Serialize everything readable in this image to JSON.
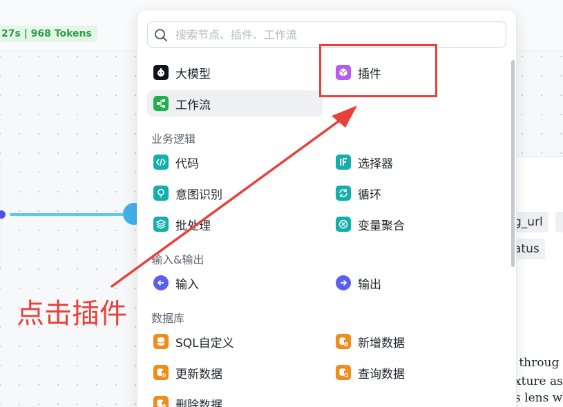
{
  "canvas": {
    "run_stats": "27s | 968 Tokens",
    "right_node": {
      "tags": [
        "g_url",
        "atus"
      ],
      "description_lines": [
        "n throug",
        "exture as",
        "es lens w"
      ]
    }
  },
  "node_picker": {
    "search": {
      "placeholder": "搜索节点、插件、工作流",
      "value": ""
    },
    "top_items": [
      {
        "label": "大模型",
        "icon": "llm-robot-icon",
        "color": "#111318"
      },
      {
        "label": "插件",
        "icon": "plugin-cube-icon",
        "color": "#b65ce8"
      },
      {
        "label": "工作流",
        "icon": "workflow-icon",
        "color": "#20b14c",
        "selected": true
      }
    ],
    "sections": [
      {
        "title": "业务逻辑",
        "items": [
          {
            "label": "代码",
            "icon": "code-icon",
            "color": "#16aeab"
          },
          {
            "label": "选择器",
            "icon": "if-selector-icon",
            "color": "#16aeab"
          },
          {
            "label": "意图识别",
            "icon": "intent-bulb-icon",
            "color": "#16aeab"
          },
          {
            "label": "循环",
            "icon": "loop-icon",
            "color": "#16aeab"
          },
          {
            "label": "批处理",
            "icon": "batch-layers-icon",
            "color": "#16aeab"
          },
          {
            "label": "变量聚合",
            "icon": "variable-merge-icon",
            "color": "#16aeab"
          }
        ]
      },
      {
        "title": "输入&输出",
        "items": [
          {
            "label": "输入",
            "icon": "input-arrow-icon",
            "color": "#5a5ff0"
          },
          {
            "label": "输出",
            "icon": "output-arrow-icon",
            "color": "#5a5ff0"
          }
        ]
      },
      {
        "title": "数据库",
        "items": [
          {
            "label": "SQL自定义",
            "icon": "database-icon",
            "color": "#f08c1a"
          },
          {
            "label": "新增数据",
            "icon": "database-add-icon",
            "color": "#f08c1a"
          },
          {
            "label": "更新数据",
            "icon": "database-update-icon",
            "color": "#f08c1a"
          },
          {
            "label": "查询数据",
            "icon": "database-search-icon",
            "color": "#f08c1a"
          },
          {
            "label": "删除数据",
            "icon": "database-delete-icon",
            "color": "#f08c1a"
          }
        ]
      }
    ]
  },
  "annotation": {
    "text": "点击插件",
    "color": "#e8403b"
  }
}
